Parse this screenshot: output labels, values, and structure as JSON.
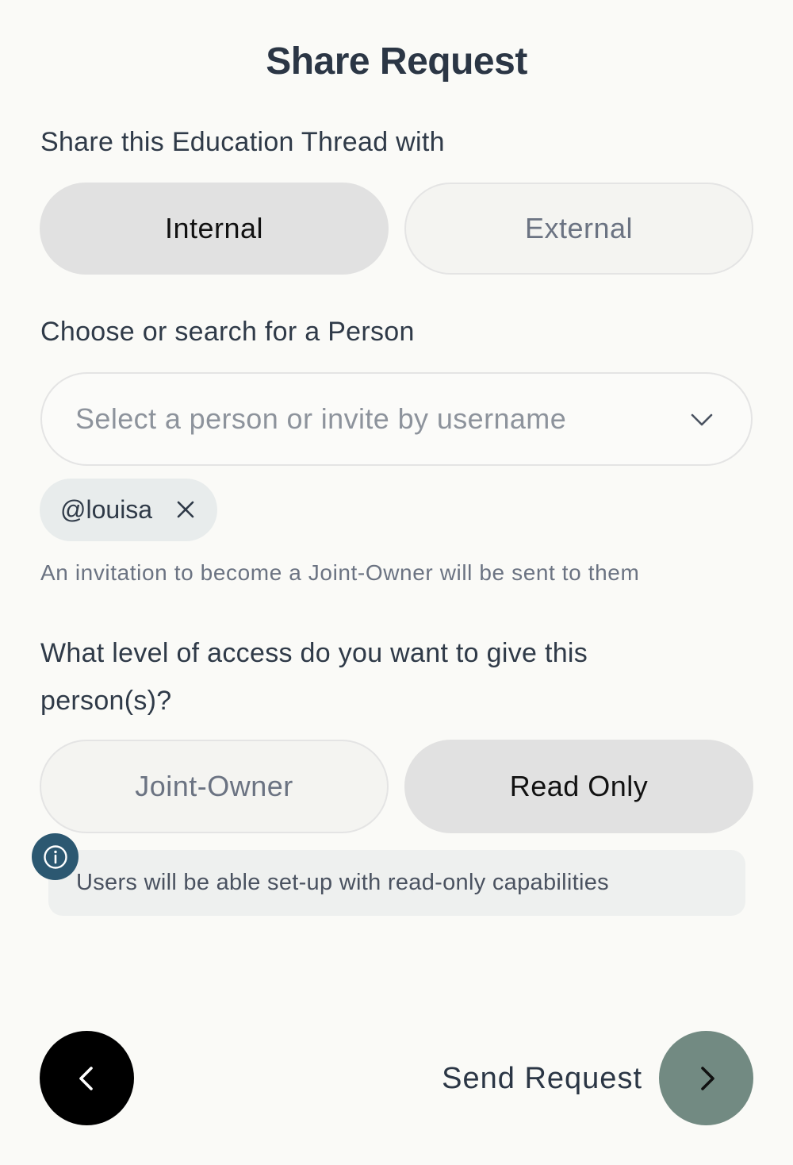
{
  "header": {
    "title": "Share Request"
  },
  "share_with": {
    "label": "Share this Education Thread with",
    "options": [
      {
        "label": "Internal",
        "selected": true
      },
      {
        "label": "External",
        "selected": false
      }
    ]
  },
  "person": {
    "label": "Choose or search for a Person",
    "placeholder": "Select a person or invite by username",
    "chips": [
      {
        "label": "@louisa"
      }
    ],
    "helper": "An invitation to become a Joint-Owner will be sent to them"
  },
  "access": {
    "question": "What level of access do you want to give this person(s)?",
    "options": [
      {
        "label": "Joint-Owner",
        "selected": false
      },
      {
        "label": "Read Only",
        "selected": true
      }
    ],
    "info": "Users will be able set-up with read-only capabilities"
  },
  "footer": {
    "send_label": "Send Request"
  },
  "colors": {
    "background": "#fafaf7",
    "active_pill": "#e1e1e1",
    "info_icon": "#2c5871",
    "next_button": "#728a82",
    "back_button": "#000000"
  }
}
